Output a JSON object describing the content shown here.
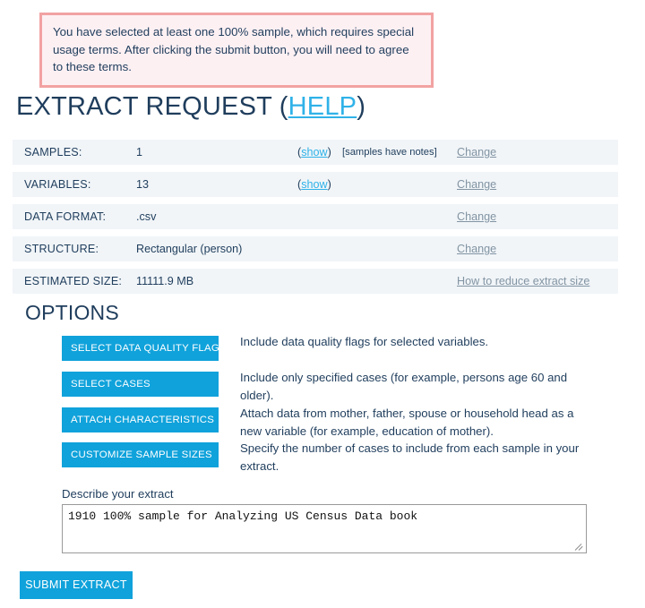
{
  "alert": {
    "message": "You have selected at least one 100% sample, which requires special usage terms. After clicking the submit button, you will need to agree to these terms."
  },
  "title": {
    "main": "EXTRACT REQUEST ",
    "open_paren": "(",
    "help_label": "HELP",
    "close_paren": ")"
  },
  "summary": {
    "rows": [
      {
        "label": "SAMPLES:",
        "value": "1",
        "show_open": "(",
        "show_label": "show",
        "show_close": ")",
        "notes": "[samples have notes]",
        "action": "Change"
      },
      {
        "label": "VARIABLES:",
        "value": "13",
        "show_open": "(",
        "show_label": "show",
        "show_close": ")",
        "notes": "",
        "action": "Change"
      },
      {
        "label": "DATA FORMAT:",
        "value": ".csv",
        "show_open": "",
        "show_label": "",
        "show_close": "",
        "notes": "",
        "action": "Change"
      },
      {
        "label": "STRUCTURE:",
        "value": "Rectangular (person)",
        "show_open": "",
        "show_label": "",
        "show_close": "",
        "notes": "",
        "action": "Change"
      },
      {
        "label": "ESTIMATED SIZE:",
        "value": "11111.9 MB",
        "show_open": "",
        "show_label": "",
        "show_close": "",
        "notes": "",
        "action": "How to reduce extract size"
      }
    ]
  },
  "options": {
    "heading": "OPTIONS",
    "items": [
      {
        "button": "SELECT DATA QUALITY FLAGS",
        "description": "Include data quality flags for selected variables."
      },
      {
        "button": "SELECT CASES",
        "description": "Include only specified cases (for example, persons age 60 and older)."
      },
      {
        "button": "ATTACH CHARACTERISTICS",
        "description": "Attach data from mother, father, spouse or household head as a new variable (for example, education of mother)."
      },
      {
        "button": "CUSTOMIZE SAMPLE SIZES",
        "description": "Specify the number of cases to include from each sample in your extract."
      }
    ]
  },
  "describe": {
    "label": "Describe your extract",
    "value": "1910 100% sample for Analyzing US Census Data book"
  },
  "submit": {
    "label": "SUBMIT EXTRACT"
  },
  "colors": {
    "accent_blue": "#10a2db",
    "link_blue": "#2fb2e8",
    "text_navy": "#1f3d5c",
    "muted_link": "#8294a3",
    "alert_border": "#f2a2a2",
    "alert_bg": "#fdf0f3",
    "row_bg": "#f1f5f8"
  }
}
